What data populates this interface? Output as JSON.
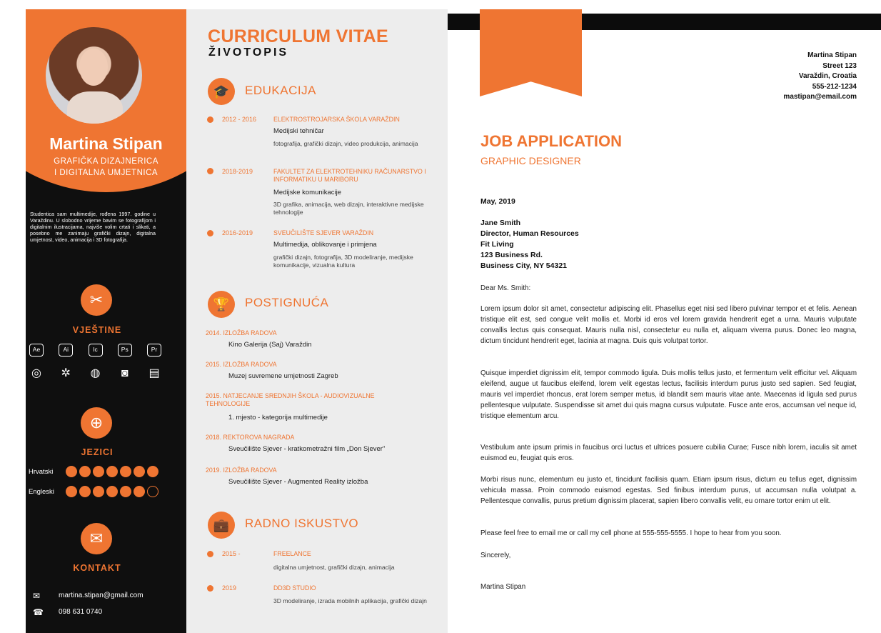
{
  "sidebar": {
    "name": "Martina Stipan",
    "role_line1": "GRAFIČKA DIZAJNERICA",
    "role_line2": "I DIGITALNA UMJETNICA",
    "bio": "Studentica sam multimedije, rođena 1997. godine u Varaždinu. U slobodno vrijeme bavim se fotografijom i digitalnim ilustracijama, najviše volim crtati i slikati, a posebno me zanimaju grafički dizajn, digitalna umjetnost, video, animacija i 3D fotografija.",
    "skills_heading": "VJEŠTINE",
    "software": [
      "Ae",
      "Ai",
      "Ic",
      "Ps",
      "Pr"
    ],
    "tools_icons": [
      "target-icon",
      "blender-icon",
      "cinema4d-icon",
      "camera-icon",
      "clapper-icon"
    ],
    "languages_heading": "JEZICI",
    "languages": [
      {
        "name": "Hrvatski",
        "level": 7,
        "max": 7
      },
      {
        "name": "Engleski",
        "level": 6,
        "max": 7
      }
    ],
    "contact_heading": "KONTAKT",
    "email": "martina.stipan@gmail.com",
    "phone": "098 631 0740"
  },
  "cv": {
    "title": "CURRICULUM VITAE",
    "subtitle": "ŽIVOTOPIS",
    "education_heading": "EDUKACIJA",
    "education": [
      {
        "years": "2012 - 2016",
        "school": "ELEKTROSTROJARSKA ŠKOLA VARAŽDIN",
        "degree": "Medijski tehničar",
        "details": "fotografija, grafički dizajn, video produkcija, animacija"
      },
      {
        "years": "2018-2019",
        "school": "FAKULTET ZA ELEKTROTEHNIKU RAČUNARSTVO I INFORMATIKU U MARIBORU",
        "degree": "Medijske komunikacije",
        "details": "3D grafika, animacija, web dizajn, interaktivne medijske tehnologije"
      },
      {
        "years": "2016-2019",
        "school": "SVEUČILIŠTE SJEVER VARAŽDIN",
        "degree": "Multimedija, oblikovanje i primjena",
        "details": "grafički dizajn, fotografija, 3D modeliranje, medijske komunikacije, vizualna kultura"
      }
    ],
    "achievements_heading": "POSTIGNUĆA",
    "achievements": [
      {
        "title": "2014. IZLOŽBA RADOVA",
        "body": "Kino Galerija (Saj) Varaždin"
      },
      {
        "title": "2015. IZLOŽBA RADOVA",
        "body": "Muzej suvremene umjetnosti Zagreb"
      },
      {
        "title": "2015. NATJECANJE SREDNJIH ŠKOLA - AUDIOVIZUALNE TEHNOLOGIJE",
        "body": "1. mjesto - kategorija multimedije"
      },
      {
        "title": "2018. REKTOROVA NAGRADA",
        "body": "Sveučilište Sjever - kratkometražni film „Don Sjever\""
      },
      {
        "title": "2019. IZLOŽBA RADOVA",
        "body": "Sveučilište Sjever - Augmented Reality izložba"
      }
    ],
    "work_heading": "RADNO ISKUSTVO",
    "work": [
      {
        "years": "2015 -",
        "company": "FREELANCE",
        "details": "digitalna umjetnost, grafički dizajn, animacija"
      },
      {
        "years": "2019",
        "company": "DD3D STUDIO",
        "details": "3D modeliranje, izrada mobilnih aplikacija, grafički dizajn"
      }
    ]
  },
  "letter": {
    "sender": [
      "Martina Stipan",
      "Street 123",
      "Varaždin, Croatia",
      "555-212-1234",
      "mastipan@email.com"
    ],
    "title": "JOB APPLICATION",
    "subtitle": "GRAPHIC DESIGNER",
    "date": "May, 2019",
    "recipient": [
      "Jane Smith",
      "Director, Human Resources",
      "Fit Living",
      "123 Business Rd.",
      "Business City, NY 54321"
    ],
    "greeting": "Dear Ms. Smith:",
    "paragraphs": [
      "Lorem ipsum dolor sit amet, consectetur adipiscing elit. Phasellus eget nisi sed libero pulvinar tempor et et felis. Aenean tristique elit est, sed congue velit mollis et. Morbi id eros vel lorem gravida hendrerit eget a urna. Mauris vulputate convallis lectus quis consequat. Mauris nulla nisl, consectetur eu nulla et, aliquam viverra purus. Donec leo magna, dictum tincidunt hendrerit eget, lacinia at magna. Duis quis volutpat tortor.",
      "Quisque imperdiet dignissim elit, tempor commodo ligula. Duis mollis tellus justo, et fermentum velit efficitur vel. Aliquam eleifend, augue ut faucibus eleifend, lorem velit egestas lectus, facilisis interdum purus justo sed sapien. Sed feugiat, mauris vel imperdiet rhoncus, erat lorem semper metus, id blandit sem mauris vitae ante. Maecenas id ligula sed purus pellentesque vulputate. Suspendisse sit amet dui quis magna cursus vulputate. Fusce ante eros, accumsan vel neque id, tristique elementum arcu.",
      "Vestibulum ante ipsum primis in faucibus orci luctus et ultrices posuere cubilia Curae; Fusce nibh lorem, iaculis sit amet euismod eu, feugiat quis eros.",
      "Morbi risus nunc, elementum eu justo et, tincidunt facilisis quam. Etiam ipsum risus, dictum eu tellus eget, dignissim vehicula massa. Proin commodo euismod egestas. Sed finibus interdum purus, ut accumsan nulla volutpat a. Pellentesque convallis, purus pretium dignissim placerat, sapien libero convallis velit, eu ornare tortor enim ut elit.",
      "Please feel free to email me or call my cell phone at 555-555-5555. I hope to hear from you soon."
    ],
    "closing": "Sincerely,",
    "signature": "Martina Stipan"
  },
  "colors": {
    "accent": "#ef7532",
    "sidebar_bg": "#0f0f0f",
    "cv_bg": "#ededed"
  }
}
